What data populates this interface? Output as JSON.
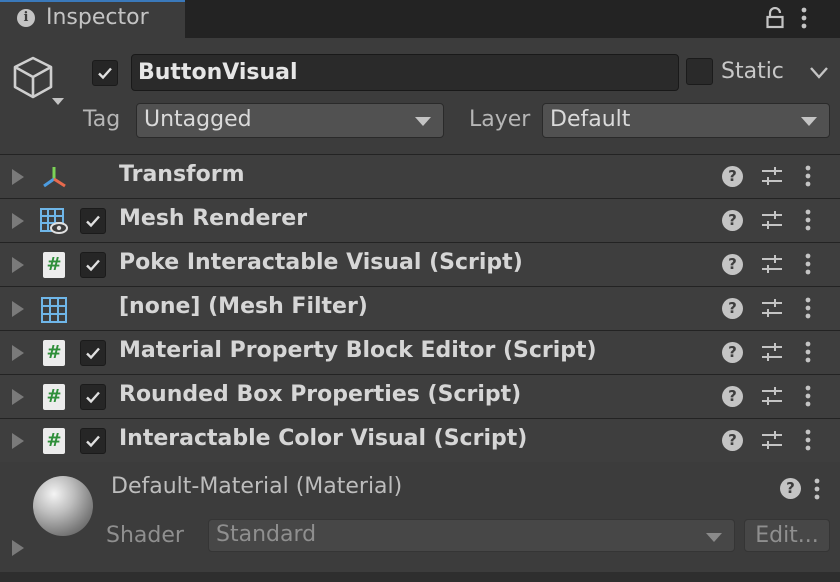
{
  "tab": {
    "title": "Inspector"
  },
  "gameobject": {
    "name": "ButtonVisual",
    "active": true,
    "static_label": "Static",
    "static": false,
    "tag_label": "Tag",
    "tag_value": "Untagged",
    "layer_label": "Layer",
    "layer_value": "Default"
  },
  "components": [
    {
      "name": "Transform",
      "icon": "transform-icon",
      "has_checkbox": false,
      "enabled": null
    },
    {
      "name": "Mesh Renderer",
      "icon": "mesh-renderer-icon",
      "has_checkbox": true,
      "enabled": true
    },
    {
      "name": "Poke Interactable Visual (Script)",
      "icon": "script-icon",
      "has_checkbox": true,
      "enabled": true
    },
    {
      "name": "[none] (Mesh Filter)",
      "icon": "mesh-filter-icon",
      "has_checkbox": false,
      "enabled": null
    },
    {
      "name": "Material Property Block Editor (Script)",
      "icon": "script-icon",
      "has_checkbox": true,
      "enabled": true
    },
    {
      "name": "Rounded Box Properties (Script)",
      "icon": "script-icon",
      "has_checkbox": true,
      "enabled": true
    },
    {
      "name": "Interactable Color Visual (Script)",
      "icon": "script-icon",
      "has_checkbox": true,
      "enabled": true
    }
  ],
  "icons": {
    "help": "?",
    "script": "#"
  },
  "material": {
    "name": "Default-Material (Material)",
    "shader_label": "Shader",
    "shader_value": "Standard",
    "edit_label": "Edit..."
  },
  "colors": {
    "accent": "#3a79bb",
    "script_green": "#2f8f3a"
  }
}
